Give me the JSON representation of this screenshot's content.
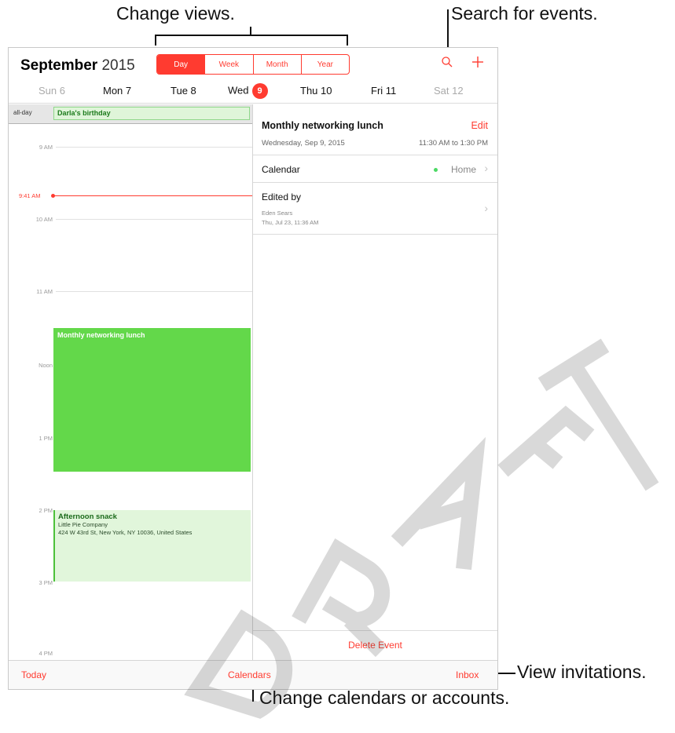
{
  "callouts": {
    "change_views": "Change views.",
    "search_events": "Search for events.",
    "view_invitations": "View invitations.",
    "change_calendars": "Change calendars or accounts."
  },
  "header": {
    "month_bold": "September",
    "year": "2015",
    "views": [
      "Day",
      "Week",
      "Month",
      "Year"
    ],
    "active_view": "Day",
    "search_icon": "search-icon",
    "add_icon": "plus-icon"
  },
  "week": {
    "days": [
      {
        "label": "Sun 6",
        "state": "dim"
      },
      {
        "label": "Mon 7",
        "state": "normal"
      },
      {
        "label": "Tue 8",
        "state": "normal"
      },
      {
        "label": "Wed",
        "state": "selected",
        "number": "9"
      },
      {
        "label": "Thu 10",
        "state": "normal"
      },
      {
        "label": "Fri 11",
        "state": "normal"
      },
      {
        "label": "Sat 12",
        "state": "dim"
      }
    ]
  },
  "day_view": {
    "allday_label": "all-day",
    "allday_event": "Darla's birthday",
    "hours": [
      "9 AM",
      "10 AM",
      "11 AM",
      "Noon",
      "1 PM",
      "2 PM",
      "3 PM",
      "4 PM"
    ],
    "now_label": "9:41 AM",
    "events": [
      {
        "title": "Monthly networking lunch"
      },
      {
        "title": "Afternoon snack",
        "location": "Little Pie Company",
        "address": "424 W 43rd St, New York, NY  10036, United States"
      }
    ]
  },
  "detail": {
    "title": "Monthly networking lunch",
    "edit_label": "Edit",
    "date": "Wednesday, Sep 9, 2015",
    "time": "11:30 AM to 1:30 PM",
    "calendar_label": "Calendar",
    "calendar_value": "Home",
    "edited_by_label": "Edited by",
    "edited_by_name": "Eden Sears",
    "edited_by_date": "Thu, Jul 23, 11:36 AM",
    "delete_label": "Delete Event"
  },
  "toolbar": {
    "today": "Today",
    "calendars": "Calendars",
    "inbox": "Inbox"
  },
  "watermark": "DRAFT",
  "colors": {
    "accent": "#ff3b30",
    "event_green": "#63d84a",
    "event_light_green": "#e1f6db"
  }
}
